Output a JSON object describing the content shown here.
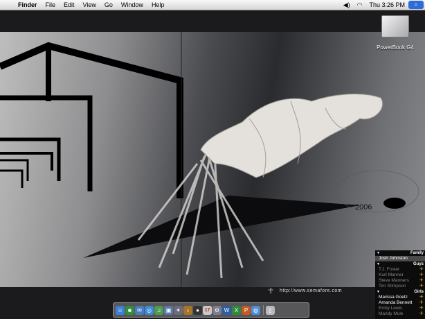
{
  "menubar": {
    "app_name": "Finder",
    "menus": [
      "File",
      "Edit",
      "View",
      "Go",
      "Window",
      "Help"
    ],
    "clock": "Thu 3:26 PM"
  },
  "desktop": {
    "drive_label": "PowerBook G4",
    "wallpaper_year": "2006",
    "wallpaper_url": "http://www.semafore.com"
  },
  "buddy_list": {
    "groups": [
      {
        "name": "Family",
        "buddies": [
          {
            "name": "Josh Johnston",
            "status": "selected"
          }
        ]
      },
      {
        "name": "Guys",
        "buddies": [
          {
            "name": "T.J. Foster",
            "status": "away"
          },
          {
            "name": "Kurt Manner",
            "status": "away"
          },
          {
            "name": "Steve Manners",
            "status": "away"
          },
          {
            "name": "Tim Stimpson",
            "status": "away"
          }
        ]
      },
      {
        "name": "Girls",
        "buddies": [
          {
            "name": "Marissa Goetz",
            "status": "online"
          },
          {
            "name": "Amanda Bennett",
            "status": "online"
          },
          {
            "name": "Emily Lewis",
            "status": "away"
          },
          {
            "name": "Mandy Mule",
            "status": "away"
          }
        ]
      }
    ]
  },
  "dock": {
    "calendar_date": "17",
    "items": [
      {
        "name": "finder-icon",
        "color": "#3d7fd6",
        "glyph": "☺"
      },
      {
        "name": "aim-icon",
        "color": "#2f8f3a",
        "glyph": "☻"
      },
      {
        "name": "mail-icon",
        "color": "#4a7cc0",
        "glyph": "✉"
      },
      {
        "name": "safari-icon",
        "color": "#3a8ad8",
        "glyph": "◎"
      },
      {
        "name": "itunes-icon",
        "color": "#4e9a4e",
        "glyph": "♫"
      },
      {
        "name": "iphoto-icon",
        "color": "#5a79a8",
        "glyph": "▣"
      },
      {
        "name": "imovie-icon",
        "color": "#6b6b7b",
        "glyph": "✶"
      },
      {
        "name": "garageband-icon",
        "color": "#a8742a",
        "glyph": "♪"
      },
      {
        "name": "dvd-icon",
        "color": "#333333",
        "glyph": "●"
      },
      {
        "name": "ical-icon",
        "color": "#c9c9c9",
        "glyph": ""
      },
      {
        "name": "system-preferences-icon",
        "color": "#7d7d8a",
        "glyph": "⚙"
      },
      {
        "name": "word-icon",
        "color": "#2a5ea8",
        "glyph": "W"
      },
      {
        "name": "excel-icon",
        "color": "#2e8b3e",
        "glyph": "X"
      },
      {
        "name": "powerpoint-icon",
        "color": "#c45a22",
        "glyph": "P"
      },
      {
        "name": "network-icon",
        "color": "#4d8fd6",
        "glyph": "◍"
      },
      {
        "name": "trash-icon",
        "color": "#b9b9bd",
        "glyph": "▯"
      }
    ]
  }
}
